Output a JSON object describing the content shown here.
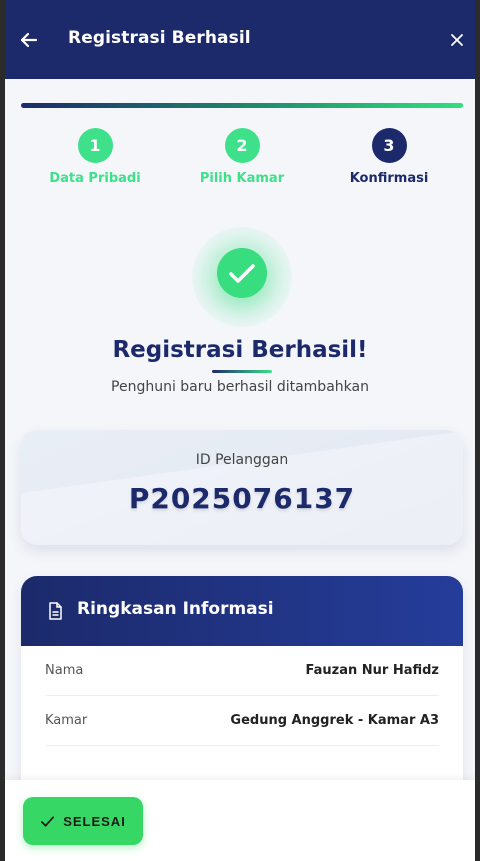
{
  "header": {
    "title": "Registrasi Berhasil",
    "back_icon": "arrow-left-icon",
    "close_icon": "close-icon"
  },
  "colors": {
    "primary": "#1c2a6b",
    "success": "#3ee18a",
    "button": "#36d764"
  },
  "steps": [
    {
      "number": "1",
      "label": "Data Pribadi",
      "state": "done"
    },
    {
      "number": "2",
      "label": "Pilih Kamar",
      "state": "done"
    },
    {
      "number": "3",
      "label": "Konfirmasi",
      "state": "active"
    }
  ],
  "success": {
    "icon": "check-icon",
    "title": "Registrasi Berhasil!",
    "subtitle": "Penghuni baru berhasil ditambahkan"
  },
  "customer": {
    "id_label": "ID Pelanggan",
    "id_value": "P2025076137"
  },
  "summary": {
    "icon": "document-icon",
    "title": "Ringkasan Informasi",
    "rows": [
      {
        "label": "Nama",
        "value": "Fauzan Nur Hafidz"
      },
      {
        "label": "Kamar",
        "value": "Gedung Anggrek - Kamar A3"
      }
    ]
  },
  "footer": {
    "done_label": "SELESAI",
    "done_icon": "check-icon"
  }
}
